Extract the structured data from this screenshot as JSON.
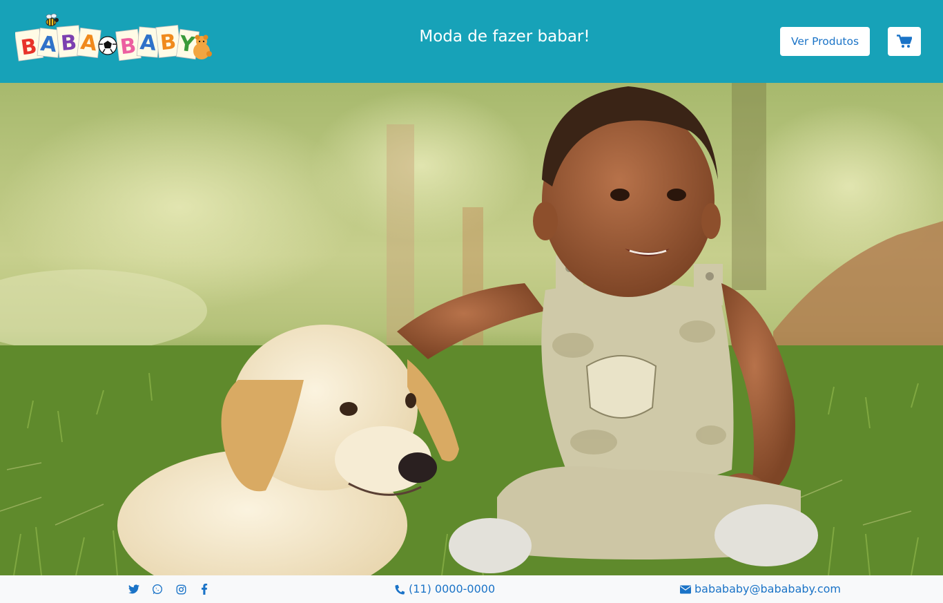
{
  "header": {
    "logo_text": "BABABABY",
    "tagline": "Moda de fazer babar!",
    "products_button": "Ver Produtos",
    "cart_icon": "shopping-cart-icon"
  },
  "hero": {
    "image": "toddler-sitting-with-puppy-on-grass"
  },
  "footer": {
    "social": [
      {
        "network": "twitter",
        "icon": "twitter-icon"
      },
      {
        "network": "whatsapp",
        "icon": "whatsapp-icon"
      },
      {
        "network": "instagram",
        "icon": "instagram-icon"
      },
      {
        "network": "facebook",
        "icon": "facebook-icon"
      }
    ],
    "phone": "(11) 0000-0000",
    "email": "babababy@babababy.com",
    "phone_icon": "phone-icon",
    "email_icon": "envelope-icon"
  },
  "colors": {
    "header_bg": "#17a2b8",
    "link_blue": "#1a73c7",
    "footer_bg": "#f8f9fa"
  }
}
